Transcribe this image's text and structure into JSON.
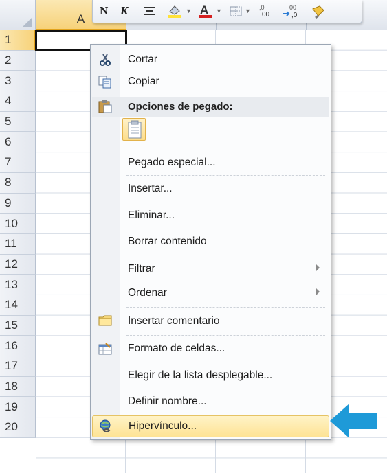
{
  "spreadsheet": {
    "columns": [
      "A"
    ],
    "rows": [
      "1",
      "2",
      "3",
      "4",
      "5",
      "6",
      "7",
      "8",
      "9",
      "10",
      "11",
      "12",
      "13",
      "14",
      "15",
      "16",
      "17",
      "18",
      "19",
      "20"
    ]
  },
  "mini_toolbar": {
    "bold_label": "N",
    "italic_label": "K"
  },
  "context_menu": {
    "items": {
      "cut": "Cortar",
      "copy": "Copiar",
      "paste_options": "Opciones de pegado:",
      "paste_special": "Pegado especial...",
      "insert": "Insertar...",
      "delete": "Eliminar...",
      "clear_contents": "Borrar contenido",
      "filter": "Filtrar",
      "sort": "Ordenar",
      "insert_comment": "Insertar comentario",
      "format_cells": "Formato de celdas...",
      "pick_from_list": "Elegir de la lista desplegable...",
      "define_name": "Definir nombre...",
      "hyperlink": "Hipervínculo..."
    },
    "highlighted_item": "hyperlink"
  },
  "colors": {
    "highlight": "#fde395",
    "arrow": "#1e9ad8",
    "selected_header": "#f7d27a"
  },
  "icons": [
    "scissors-icon",
    "copy-icon",
    "clipboard-icon",
    "paste-icon",
    "comment-icon",
    "format-cells-icon",
    "hyperlink-icon",
    "submenu-arrow-icon",
    "pointer-arrow-icon"
  ]
}
